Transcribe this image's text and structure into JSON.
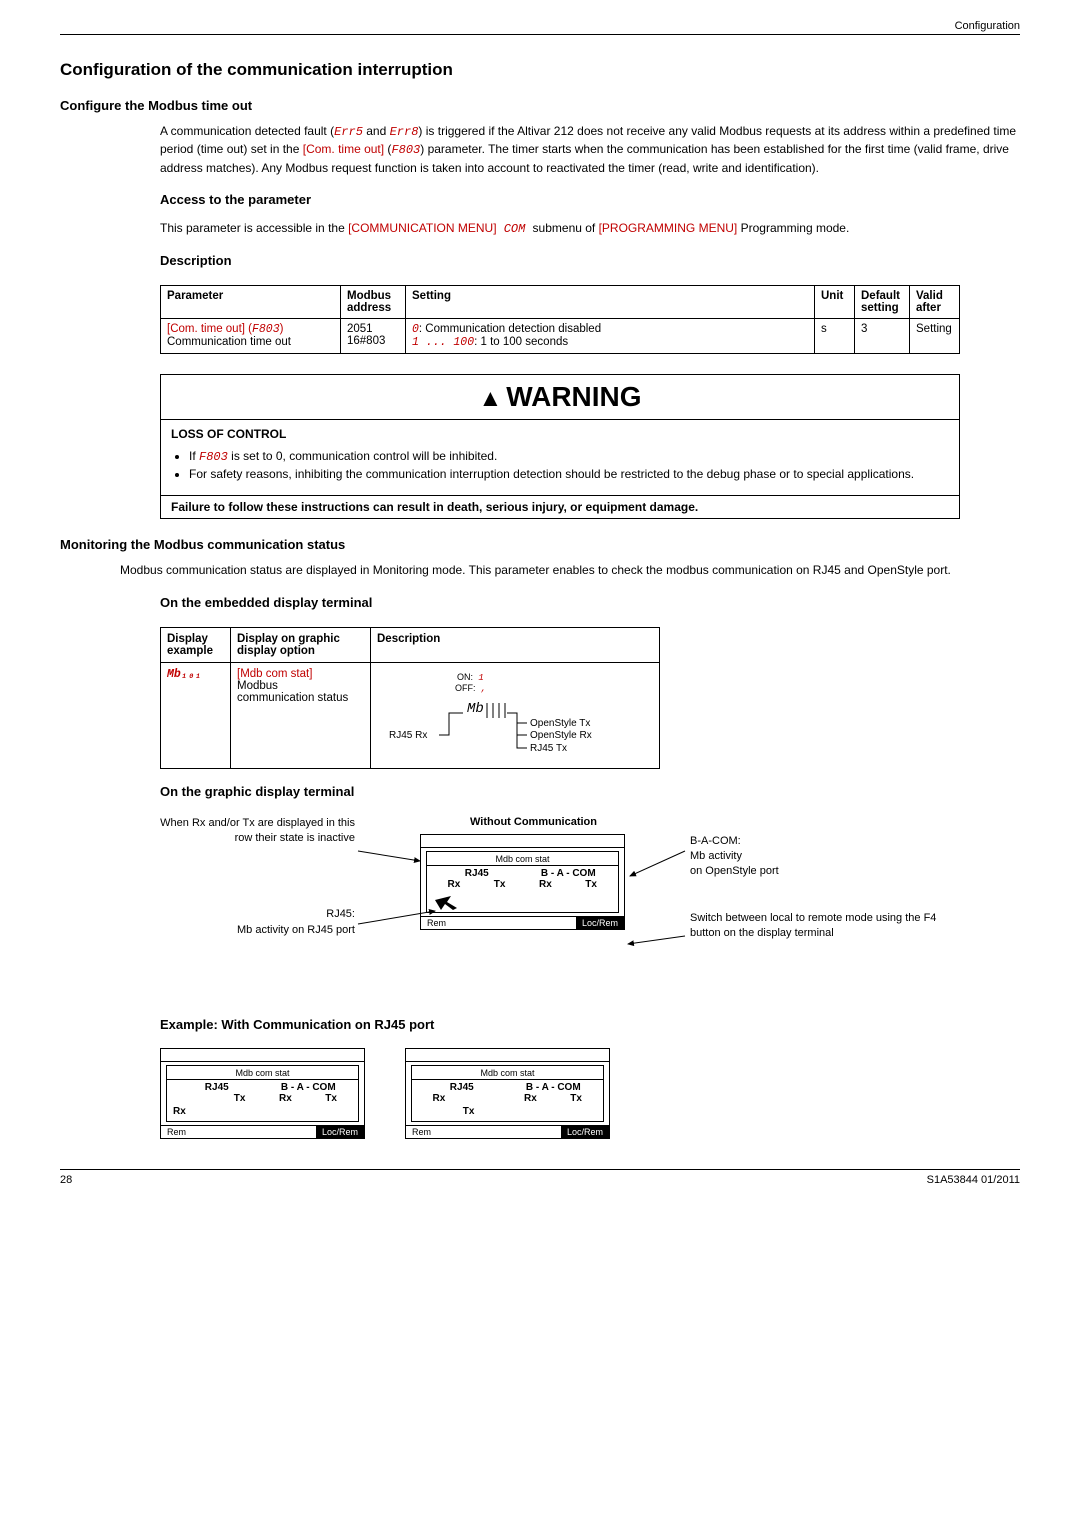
{
  "header": {
    "right": "Configuration"
  },
  "section": {
    "title": "Configuration of the communication interruption"
  },
  "configure": {
    "heading": "Configure the Modbus time out",
    "p1_a": "A communication detected fault (",
    "p1_seg1": "Err5",
    "p1_mid": " and ",
    "p1_seg2": "Err8",
    "p1_b": ") is triggered if the Altivar 212 does not receive any valid Modbus requests at its address within a predefined time period (time out) set in the ",
    "p1_link": "[Com. time out]",
    "p1_paramL": " (",
    "p1_param": "F803",
    "p1_paramR": ")",
    "p1_c": " parameter. The timer starts when the communication has been established for the first time (valid frame, drive address matches). Any Modbus request function is taken into account to reactivated the timer (read, write and identification)."
  },
  "access": {
    "heading": "Access to the parameter",
    "text_a": "This parameter is accessible in the ",
    "link1": "[COMMUNICATION MENU]",
    "seg": " COM ",
    "text_b": "submenu of ",
    "link2": "[PROGRAMMING MENU]",
    "text_c": " Programming mode."
  },
  "description": {
    "heading": "Description"
  },
  "table1": {
    "hdr": {
      "c1": "Parameter",
      "c2": "Modbus address",
      "c3": "Setting",
      "c4": "Unit",
      "c5": "Default setting",
      "c6": "Valid after"
    },
    "row": {
      "c1_link": "[Com. time out]",
      "c1_segL": " (",
      "c1_seg": "F803",
      "c1_segR": ")",
      "c1_line2": "Communication time out",
      "c2a": "2051",
      "c2b": "16#803",
      "c3_seg1": "0",
      "c3_a": ": Communication detection disabled",
      "c3_seg2": "1 ... 100",
      "c3_b": ": 1 to 100 seconds",
      "c4": "s",
      "c5": "3",
      "c6": "Setting"
    }
  },
  "warning": {
    "title": "WARNING",
    "sub": "LOSS OF CONTROL",
    "li1_a": "If ",
    "li1_seg": "F803",
    "li1_b": " is set to 0, communication control will be inhibited.",
    "li2": "For safety reasons, inhibiting the communication interruption detection should be restricted to the debug phase or to special applications.",
    "footer": "Failure to follow these instructions can result in death, serious injury, or equipment damage."
  },
  "monitor": {
    "heading": "Monitoring the Modbus communication status",
    "text": "Modbus communication status are displayed in Monitoring mode. This parameter enables to check the modbus communication on RJ45 and OpenStyle port.",
    "embedded": "On the embedded display terminal"
  },
  "table2": {
    "hdr": {
      "c1": "Display example",
      "c2": "Display on graphic display option",
      "c3": "Description"
    },
    "row": {
      "c1": "Mb₁₀₁",
      "c2_link": "[Mdb com stat]",
      "c2_a": "Modbus",
      "c2_b": "communication status",
      "svg": {
        "on": "ON:",
        "on_v": " 1",
        "off": "OFF:",
        "off_v": " ,",
        "seg": "Mb",
        "rj45rx": "RJ45 Rx",
        "ostx": "OpenStyle Tx",
        "osrx": "OpenStyle Rx",
        "rj45tx": "RJ45 Tx"
      }
    }
  },
  "graphic": {
    "heading": "On the graphic display terminal",
    "without": "Without Communication",
    "lefttop": "When Rx and/or Tx are displayed in this row their state is inactive",
    "leftmid": "RJ45:",
    "leftmid2": "Mb activity on RJ45 port",
    "righttop": "B-A-COM:",
    "righttop2": "Mb activity",
    "righttop3": "on OpenStyle port",
    "rightbot": "Switch between local to remote mode using the F4 button on the display terminal"
  },
  "screen": {
    "title": "Mdb com stat",
    "h1": "RJ45",
    "h2": "B - A - COM",
    "rx": "Rx",
    "tx": "Tx",
    "rem": "Rem",
    "locrem": "Loc/Rem"
  },
  "example": {
    "heading": "Example: With Communication on RJ45 port"
  },
  "footer": {
    "page": "28",
    "ref": "S1A53844 01/2011"
  }
}
